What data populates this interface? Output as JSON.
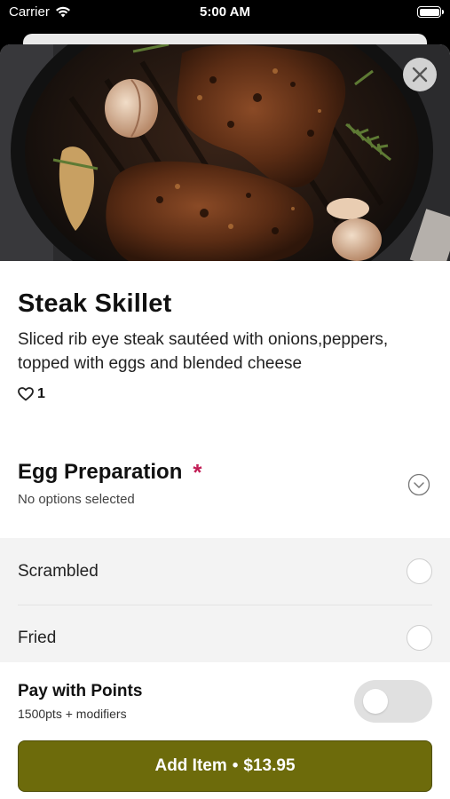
{
  "status_bar": {
    "carrier": "Carrier",
    "time": "5:00 AM",
    "wifi_icon": "wifi-icon",
    "battery_icon": "battery-icon"
  },
  "item": {
    "title": "Steak Skillet",
    "description": "Sliced rib eye steak sautéed with onions,peppers, topped with eggs and blended cheese",
    "likes_count": "1",
    "like_icon": "heart-outline-icon",
    "image_icon": "food-photo"
  },
  "close_icon": "close-icon",
  "modifier_group": {
    "title": "Egg Preparation",
    "required_mark": "*",
    "status": "No options selected",
    "expand_icon": "chevron-down-circle-icon",
    "options": [
      {
        "label": "Scrambled",
        "selected": false
      },
      {
        "label": "Fried",
        "selected": false
      }
    ]
  },
  "points": {
    "title": "Pay with Points",
    "subtitle": "1500pts + modifiers",
    "toggle_on": false
  },
  "add_button": {
    "label": "Add Item",
    "separator": "•",
    "price": "$13.95"
  },
  "colors": {
    "accent": "#6d6b0b",
    "required": "#c21e56",
    "options_bg": "#f3f3f3",
    "toggle_off": "#e0e0e0"
  }
}
